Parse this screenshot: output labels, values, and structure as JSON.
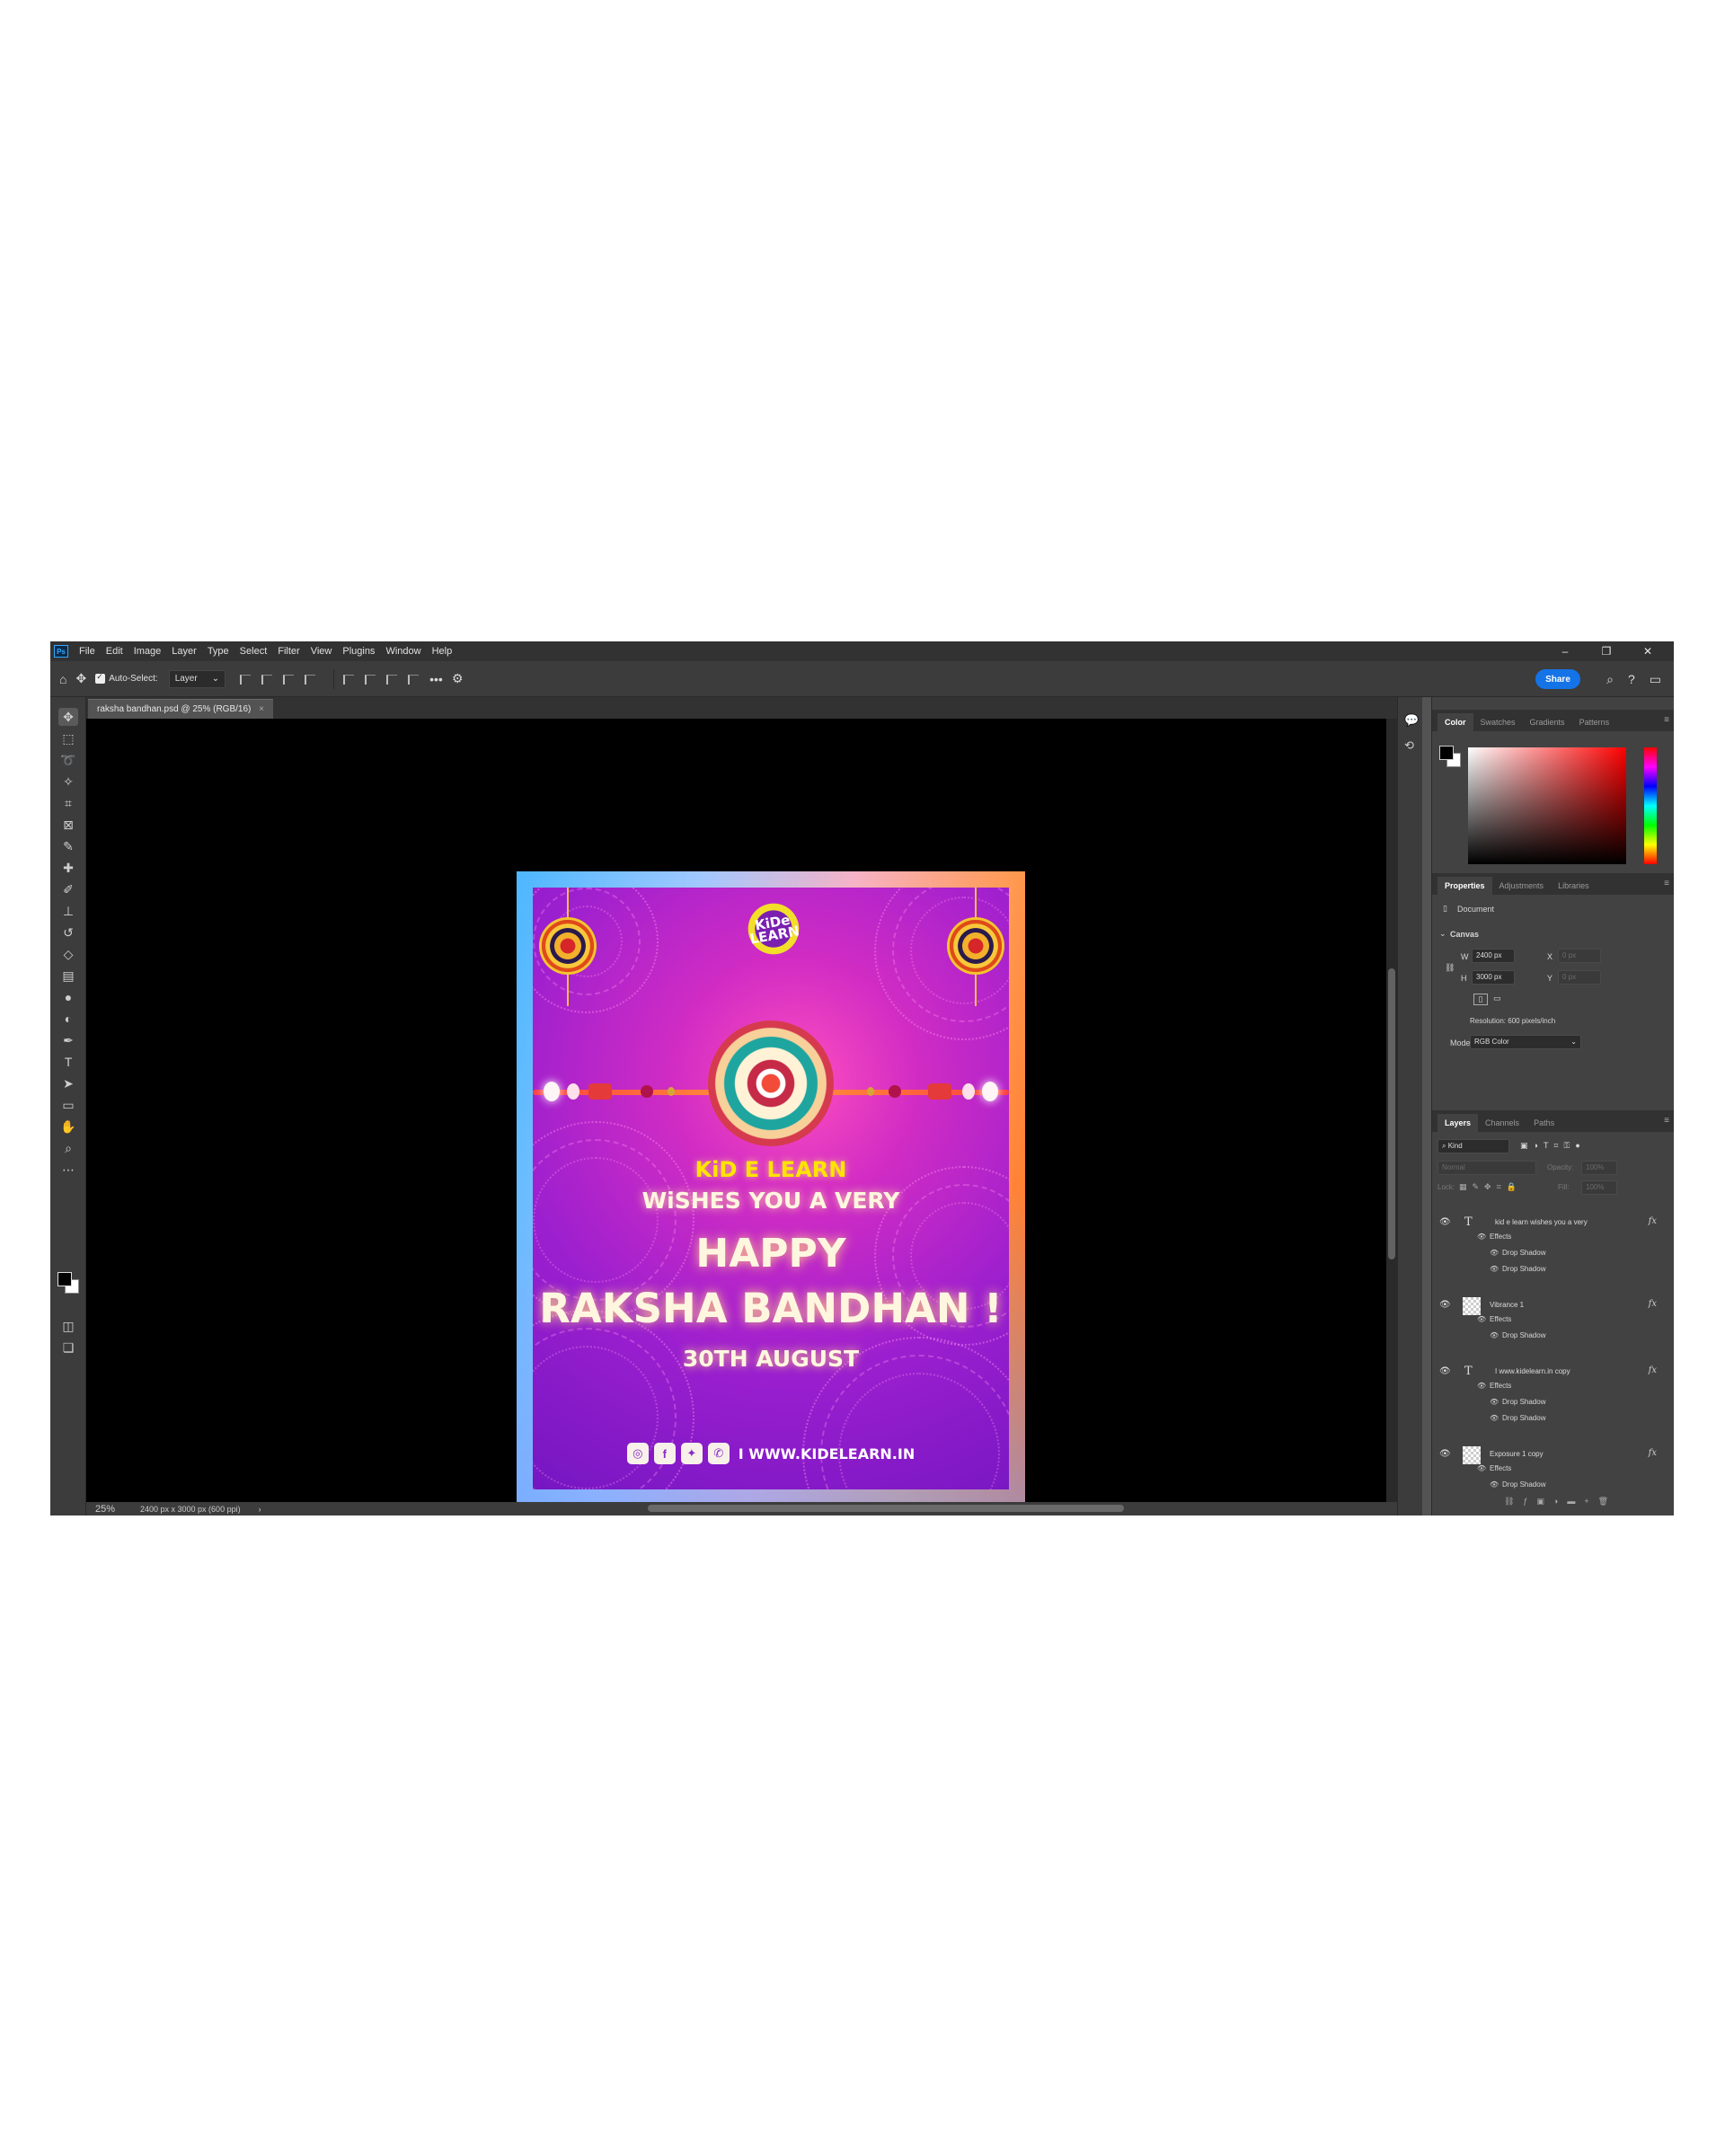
{
  "menu": [
    "File",
    "Edit",
    "Image",
    "Layer",
    "Type",
    "Select",
    "Filter",
    "View",
    "Plugins",
    "Window",
    "Help"
  ],
  "app_logo": "Ps",
  "window_controls": {
    "minimize": "–",
    "maximize": "❐",
    "close": "✕"
  },
  "options": {
    "auto_select_label": "Auto-Select:",
    "auto_select_value": "Layer",
    "more": "•••",
    "share_label": "Share"
  },
  "document": {
    "tab_title": "raksha bandhan.psd @ 25% (RGB/16)",
    "tab_close": "×",
    "zoom": "25%",
    "status": "2400 px x 3000 px (600 ppi)"
  },
  "artwork": {
    "logo_text": "KiDe LEARN",
    "line1": "KiD E LEARN",
    "line2": "WiSHES YOU A VERY",
    "line3": "HAPPY",
    "line4": "RAKSHA BANDHAN !",
    "line5": "30TH AUGUST",
    "url": "I WWW.KIDELEARN.IN",
    "colors": {
      "accent_yellow": "#ffe400",
      "bg_purple": "#9b1fcf",
      "bg_pink": "#ff4fbf"
    }
  },
  "color_panel": {
    "tabs": [
      "Color",
      "Swatches",
      "Gradients",
      "Patterns"
    ]
  },
  "properties_panel": {
    "tabs": [
      "Properties",
      "Adjustments",
      "Libraries"
    ],
    "document_label": "Document",
    "section": "Canvas",
    "w_label": "W",
    "w_value": "2400 px",
    "h_label": "H",
    "h_value": "3000 px",
    "x_label": "X",
    "x_value": "0 px",
    "y_label": "Y",
    "y_value": "0 px",
    "resolution": "Resolution: 600 pixels/inch",
    "mode_label": "Mode",
    "mode_value": "RGB Color"
  },
  "layers_panel": {
    "tabs": [
      "Layers",
      "Channels",
      "Paths"
    ],
    "filter_kind": "Kind",
    "blend_mode": "Normal",
    "opacity_label": "Opacity:",
    "opacity_value": "100%",
    "lock_label": "Lock:",
    "fill_label": "Fill:",
    "fill_value": "100%",
    "layers": [
      {
        "name": "kid e learn  wishes you a very",
        "effects": "Effects",
        "sub": [
          "Drop Shadow",
          "Drop Shadow"
        ]
      },
      {
        "name": "Vibrance 1",
        "effects": "Effects",
        "sub": [
          "Drop Shadow"
        ]
      },
      {
        "name": "I www.kidelearn.in copy",
        "effects": "Effects",
        "sub": [
          "Drop Shadow",
          "Drop Shadow"
        ]
      },
      {
        "name": "Exposure 1 copy",
        "effects": "Effects",
        "sub": [
          "Drop Shadow"
        ]
      }
    ]
  }
}
